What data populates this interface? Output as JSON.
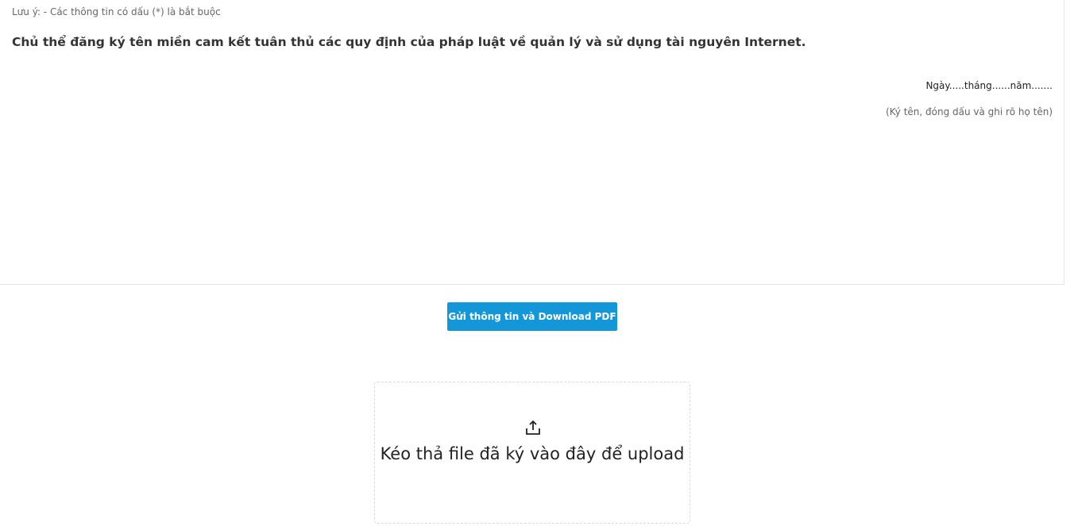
{
  "form": {
    "note": "Lưu ý: - Các thông tin có dấu (*) là bắt buộc",
    "commitment": "Chủ thể đăng ký tên miền cam kết tuân thủ các quy định của pháp luật về quản lý và sử dụng tài nguyên Internet.",
    "date_line": "Ngày.....tháng......năm.......",
    "signature_hint": "(Ký tên, đóng dấu và ghi rõ họ tên)"
  },
  "actions": {
    "submit_label": "Gửi thông tin và Download PDF"
  },
  "upload": {
    "icon": "upload-icon",
    "label": "Kéo thả file đã ký vào đây để upload"
  },
  "colors": {
    "accent": "#1497d9",
    "border": "#e6e6e6",
    "dropzone_border": "#d9d9d9"
  }
}
